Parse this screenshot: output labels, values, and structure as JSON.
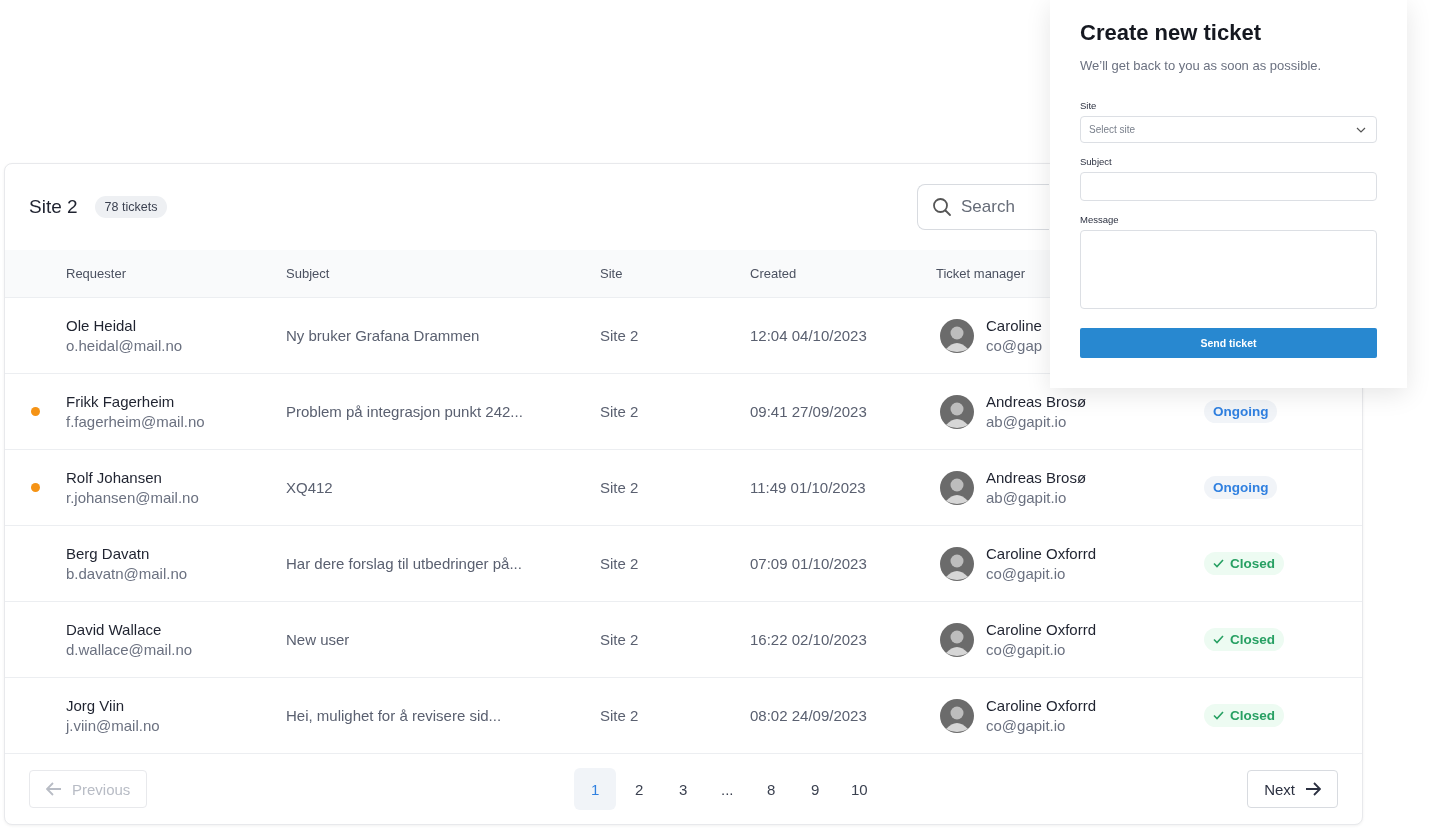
{
  "table": {
    "title": "Site 2",
    "count": "78 tickets",
    "search": {
      "placeholder": "Search"
    },
    "columns": [
      "Requester",
      "Subject",
      "Site",
      "Created",
      "Ticket manager"
    ],
    "rows": [
      {
        "unread": false,
        "name": "Ole Heidal",
        "email": "o.heidal@mail.no",
        "subject": "Ny bruker Grafana Drammen",
        "site": "Site 2",
        "created": "12:04 04/10/2023",
        "manager": "Caroline",
        "manager_email": "co@gap"
      },
      {
        "unread": true,
        "name": "Frikk Fagerheim",
        "email": "f.fagerheim@mail.no",
        "subject": "Problem på integrasjon punkt 242...",
        "site": "Site 2",
        "created": "09:41 27/09/2023",
        "manager": "Andreas Brosø",
        "manager_email": "ab@gapit.io",
        "status": {
          "kind": "ongoing",
          "label": "Ongoing"
        }
      },
      {
        "unread": true,
        "name": "Rolf Johansen",
        "email": "r.johansen@mail.no",
        "subject": "XQ412",
        "site": "Site 2",
        "created": "11:49 01/10/2023",
        "manager": "Andreas Brosø",
        "manager_email": "ab@gapit.io",
        "status": {
          "kind": "ongoing",
          "label": "Ongoing"
        }
      },
      {
        "unread": false,
        "name": "Berg Davatn",
        "email": "b.davatn@mail.no",
        "subject": "Har dere forslag til utbedringer på...",
        "site": "Site 2",
        "created": "07:09 01/10/2023",
        "manager": "Caroline Oxforrd",
        "manager_email": "co@gapit.io",
        "status": {
          "kind": "closed",
          "label": "Closed"
        }
      },
      {
        "unread": false,
        "name": "David Wallace",
        "email": "d.wallace@mail.no",
        "subject": "New user",
        "site": "Site 2",
        "created": "16:22 02/10/2023",
        "manager": "Caroline Oxforrd",
        "manager_email": "co@gapit.io",
        "status": {
          "kind": "closed",
          "label": "Closed"
        }
      },
      {
        "unread": false,
        "name": "Jorg Viin",
        "email": "j.viin@mail.no",
        "subject": "Hei, mulighet for å revisere sid...",
        "site": "Site 2",
        "created": "08:02 24/09/2023",
        "manager": "Caroline Oxforrd",
        "manager_email": "co@gapit.io",
        "status": {
          "kind": "closed",
          "label": "Closed"
        }
      }
    ]
  },
  "pagination": {
    "previous": {
      "label": "Previous",
      "disabled": true
    },
    "pages": [
      {
        "label": "1",
        "selected": true
      },
      {
        "label": "2",
        "selected": false
      },
      {
        "label": "3",
        "selected": false
      },
      {
        "label": "...",
        "selected": false
      },
      {
        "label": "8",
        "selected": false
      },
      {
        "label": "9",
        "selected": false
      },
      {
        "label": "10",
        "selected": false
      }
    ],
    "next": {
      "label": "Next",
      "disabled": false
    }
  },
  "panel": {
    "title": "Create new ticket",
    "subtitle": "We’ll get back to you as soon as possible.",
    "fields": [
      {
        "kind": "select",
        "label": "Site",
        "placeholder": "Select site"
      },
      {
        "kind": "text",
        "label": "Subject"
      },
      {
        "kind": "textarea",
        "label": "Message"
      }
    ],
    "submit": "Send ticket"
  }
}
